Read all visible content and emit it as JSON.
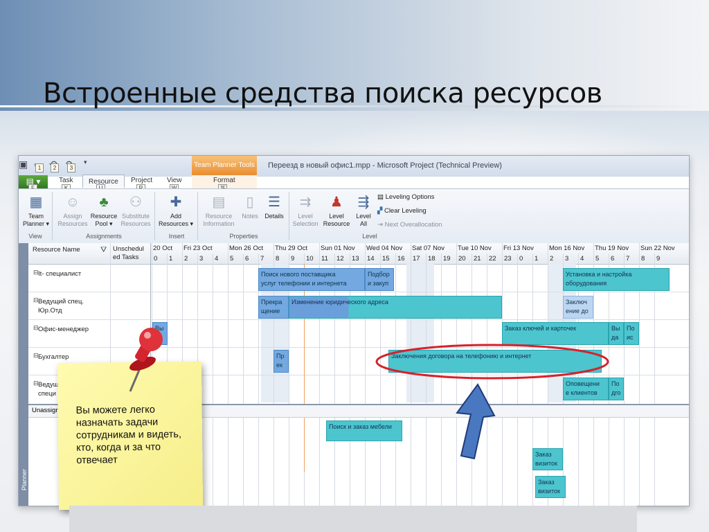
{
  "slide": {
    "title": "Встроенные средства поиска ресурсов",
    "note": "Вы можете легко назначать задачи сотрудникам и видеть, кто, когда и за что отвечает"
  },
  "window": {
    "context_tab": "Team Planner Tools",
    "title": "Переезд в новый офис1.mpp - Microsoft Project (Technical Preview)",
    "qat_badges": [
      "1",
      "2",
      "3"
    ],
    "file_key": "F",
    "tabs": [
      {
        "label": "Task",
        "key": "K"
      },
      {
        "label": "Resource",
        "key": "U"
      },
      {
        "label": "Project",
        "key": "R"
      },
      {
        "label": "View",
        "key": "W"
      },
      {
        "label": "Format",
        "key": "JF"
      }
    ]
  },
  "ribbon": {
    "team_planner": {
      "line1": "Team",
      "line2": "Planner ▾"
    },
    "assign": {
      "line1": "Assign",
      "line2": "Resources"
    },
    "pool": {
      "line1": "Resource",
      "line2": "Pool ▾"
    },
    "substitute": {
      "line1": "Substitute",
      "line2": "Resources"
    },
    "add": {
      "line1": "Add",
      "line2": "Resources ▾"
    },
    "info": {
      "line1": "Resource",
      "line2": "Information"
    },
    "notes": "Notes",
    "details": "Details",
    "level_sel": {
      "line1": "Level",
      "line2": "Selection"
    },
    "level_res": {
      "line1": "Level",
      "line2": "Resource"
    },
    "level_all": {
      "line1": "Level",
      "line2": "All"
    },
    "leveling_options": "Leveling Options",
    "clear_leveling": "Clear Leveling",
    "next_over": "Next Overallocation",
    "groups": {
      "view": "View",
      "assignments": "Assignments",
      "insert": "Insert",
      "properties": "Properties",
      "level": "Level"
    }
  },
  "grid": {
    "col_resource": "Resource Name",
    "col_unsched_1": "Unschedul",
    "col_unsched_2": "ed Tasks",
    "side_label": "Planner",
    "dates": [
      "20 Oct",
      "Fri 23 Oct",
      "Mon 26 Oct",
      "Thu 29 Oct",
      "Sun 01 Nov",
      "Wed 04 Nov",
      "Sat 07 Nov",
      "Tue 10 Nov",
      "Fri 13 Nov",
      "Mon 16 Nov",
      "Thu 19 Nov",
      "Sun 22 Nov"
    ],
    "hours": [
      "0",
      "1",
      "2",
      "3",
      "4",
      "5",
      "6",
      "7",
      "8",
      "9",
      "10",
      "11",
      "12",
      "13",
      "14",
      "15",
      "16",
      "17",
      "18",
      "19",
      "20",
      "21",
      "22",
      "23",
      "0",
      "1",
      "2",
      "3",
      "4",
      "5",
      "6",
      "7",
      "8",
      "9"
    ],
    "resources": [
      {
        "name1": "It- специалист",
        "name2": ""
      },
      {
        "name1": "Ведущий спец.",
        "name2": "Юр.Отд"
      },
      {
        "name1": "Офис-менеджер",
        "name2": ""
      },
      {
        "name1": "Бухгалтер",
        "name2": ""
      },
      {
        "name1": "Ведущ",
        "name2": "специ"
      }
    ],
    "unassigned": "Unassigne",
    "tasks": {
      "it1a": "Поиск нового поставщика",
      "it1b": "услуг телефонии и интернета",
      "it2a": "Подбор",
      "it2b": "и закуп",
      "it3a": "Установка и настройка",
      "it3b": "оборудования",
      "yu1a": "Прекра",
      "yu1b": "щение",
      "yu2": "Изменение юридического адреса",
      "yu3a": "Заключ",
      "yu3b": "ение до",
      "of1": "Вы",
      "of2": "Заказ ключей и карточек",
      "of3a": "Вы",
      "of3b": "да",
      "of4a": "По",
      "of4b": "ис",
      "bu1a": "Пр",
      "bu1b": "ек",
      "bu2": "Заключения договора на телефонию и интернет",
      "ve1a": "Оповещени",
      "ve1b": "е клиентов",
      "ve2a": "По",
      "ve2b": "дго",
      "un1": "Поиск и заказ мебели",
      "un2a": "Заказ",
      "un2b": "визиток",
      "un3a": "Заказ",
      "un3b": "визиток"
    }
  },
  "colors": {
    "task_blue": "#73a9e0",
    "task_teal": "#4cc5cf",
    "highlight_ellipse": "#d6212b",
    "arrow": "#4a78c0",
    "note_yellow": "#fbf5a0"
  }
}
